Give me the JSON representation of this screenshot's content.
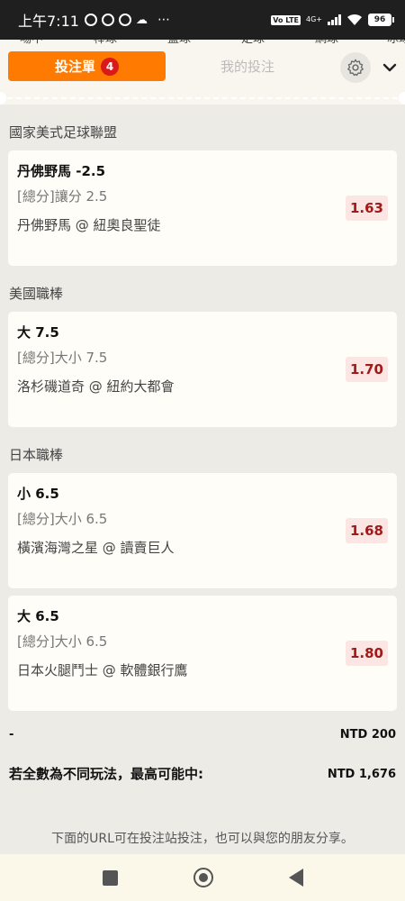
{
  "status_bar": {
    "time": "上午7:11",
    "network": "4G+",
    "volte": "Vo LTE",
    "battery": "96"
  },
  "sport_tabs": [
    "場中",
    "棒球",
    "籃球",
    "足球",
    "網球",
    "冰球"
  ],
  "header": {
    "active_tab": "投注單",
    "badge_count": "4",
    "inactive_tab": "我的投注"
  },
  "groups": [
    {
      "league": "國家美式足球聯盟",
      "bets": [
        {
          "pick": "丹佛野馬 -2.5",
          "market": "[總分]讓分 2.5",
          "match": "丹佛野馬 @ 紐奧良聖徒",
          "odds": "1.63"
        }
      ]
    },
    {
      "league": "美國職棒",
      "bets": [
        {
          "pick": "大 7.5",
          "market": "[總分]大小 7.5",
          "match": "洛杉磯道奇 @ 紐約大都會",
          "odds": "1.70"
        }
      ]
    },
    {
      "league": "日本職棒",
      "bets": [
        {
          "pick": "小 6.5",
          "market": "[總分]大小 6.5",
          "match": "橫濱海灣之星 @ 讀賣巨人",
          "odds": "1.68"
        },
        {
          "pick": "大 6.5",
          "market": "[總分]大小 6.5",
          "match": "日本火腿鬥士 @ 軟體銀行鷹",
          "odds": "1.80"
        }
      ]
    }
  ],
  "summary": {
    "stake_label": "-",
    "stake_value": "NTD 200",
    "max_label": "若全數為不同玩法，最高可能中:",
    "max_value": "NTD 1,676"
  },
  "share_text": "下面的URL可在投注站投注，也可以與您的朋友分享。",
  "colors": {
    "accent": "#ff7a00",
    "badge": "#d9191a",
    "odds_bg": "#fbe6e4",
    "odds_text": "#a01a1a"
  }
}
